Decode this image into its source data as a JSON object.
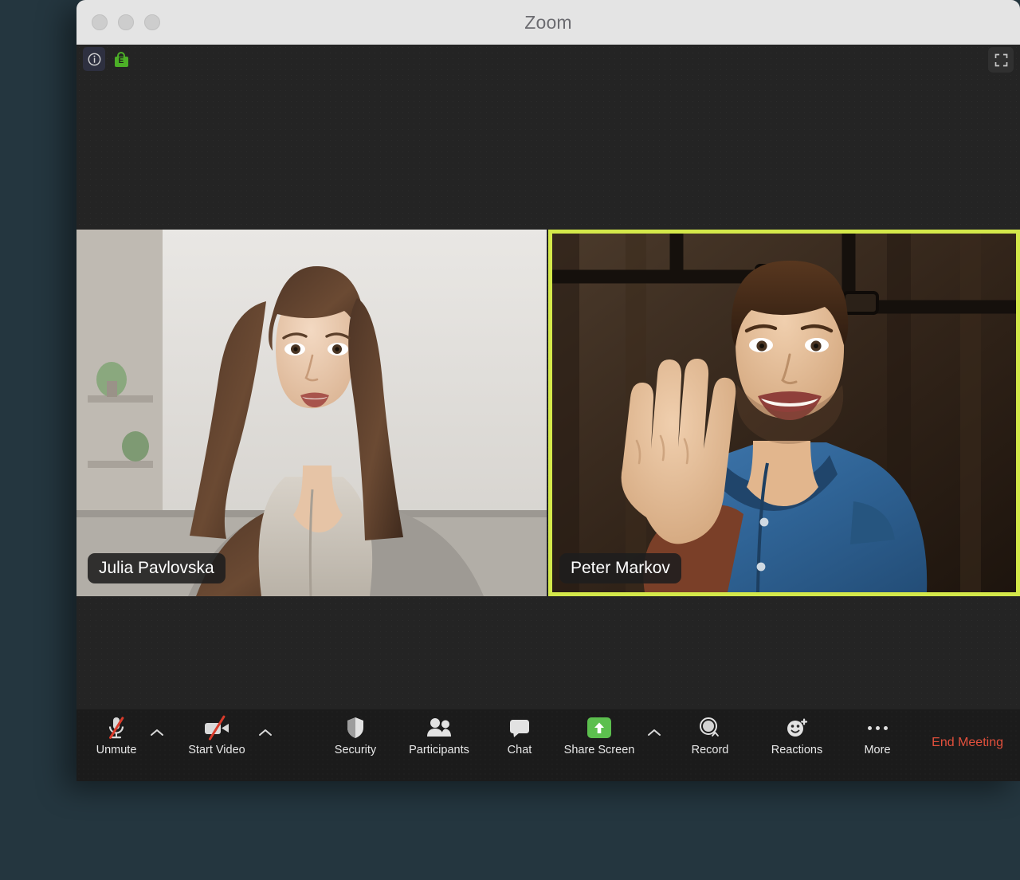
{
  "window": {
    "title": "Zoom",
    "traffic_lights": [
      "close",
      "minimize",
      "maximize"
    ]
  },
  "meeting_header": {
    "info_icon": "info-icon",
    "encryption_icon": "green-lock-icon",
    "encryption_letter": "E",
    "fullscreen_icon": "fullscreen-icon"
  },
  "participants": [
    {
      "name": "Julia Pavlovska",
      "active_speaker": false,
      "position": "left"
    },
    {
      "name": "Peter Markov",
      "active_speaker": true,
      "position": "right"
    }
  ],
  "colors": {
    "page_background": "#24363f",
    "titlebar": "#e4e4e4",
    "canvas": "#242424",
    "toolbar": "#1b1b1b",
    "active_speaker_border": "#d4e84a",
    "share_screen_green": "#5cbf4e",
    "encryption_green": "#4caf27",
    "end_meeting_red": "#e2503c",
    "mute_slash_red": "#d93b2b"
  },
  "toolbar": {
    "items": [
      {
        "label": "Unmute",
        "icon": "microphone-muted-icon",
        "has_caret": true,
        "caret_icon": "chevron-up-icon"
      },
      {
        "label": "Start Video",
        "icon": "video-off-icon",
        "has_caret": true,
        "caret_icon": "chevron-up-icon"
      },
      {
        "label": "Security",
        "icon": "shield-icon",
        "has_caret": false,
        "caret_icon": ""
      },
      {
        "label": "Participants",
        "icon": "people-icon",
        "has_caret": false,
        "caret_icon": ""
      },
      {
        "label": "Chat",
        "icon": "chat-bubble-icon",
        "has_caret": false,
        "caret_icon": ""
      },
      {
        "label": "Share Screen",
        "icon": "share-screen-icon",
        "has_caret": true,
        "caret_icon": "chevron-up-icon"
      },
      {
        "label": "Record",
        "icon": "record-icon",
        "has_caret": false,
        "caret_icon": ""
      },
      {
        "label": "Reactions",
        "icon": "reactions-smiley-icon",
        "has_caret": false,
        "caret_icon": ""
      },
      {
        "label": "More",
        "icon": "more-dots-icon",
        "has_caret": false,
        "caret_icon": ""
      }
    ],
    "end_meeting_label": "End Meeting"
  }
}
